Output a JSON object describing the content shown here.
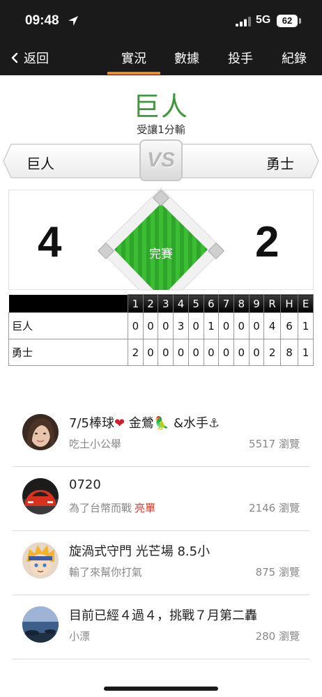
{
  "status_bar": {
    "time": "09:48",
    "network": "5G",
    "battery": "62"
  },
  "nav": {
    "back_label": "返回",
    "tabs": [
      {
        "label": "實況",
        "active": true
      },
      {
        "label": "數據",
        "active": false
      },
      {
        "label": "投手",
        "active": false
      },
      {
        "label": "紀錄",
        "active": false
      }
    ],
    "accent_color": "#f08c1e"
  },
  "game": {
    "winner": "巨人",
    "result": "受讓1分輸",
    "vs": "VS",
    "home_team": "巨人",
    "away_team": "勇士",
    "home_score": "4",
    "away_score": "2",
    "status": "完賽"
  },
  "box_score": {
    "headers": [
      "1",
      "2",
      "3",
      "4",
      "5",
      "6",
      "7",
      "8",
      "9",
      "R",
      "H",
      "E"
    ],
    "rows": [
      {
        "team": "巨人",
        "values": [
          "0",
          "0",
          "0",
          "3",
          "0",
          "1",
          "0",
          "0",
          "0",
          "4",
          "6",
          "1"
        ]
      },
      {
        "team": "勇士",
        "values": [
          "2",
          "0",
          "0",
          "0",
          "0",
          "0",
          "0",
          "0",
          "0",
          "2",
          "8",
          "1"
        ]
      }
    ]
  },
  "posts": [
    {
      "title": "7/5棒球",
      "emoji1": "❤",
      "title_mid": " 金鶯",
      "emoji2": "🦜",
      "title_mid2": " &水手",
      "emoji3": "⚓",
      "author": "吃土小公舉",
      "badge": "",
      "views": "5517 瀏覽",
      "avatar": "woman-avatar-icon"
    },
    {
      "title": "0720",
      "author": "為了台幣而戰",
      "badge": "亮單",
      "views": "2146 瀏覽",
      "avatar": "red-car-avatar-icon"
    },
    {
      "title": "旋渦式守門 光芒場 8.5小",
      "author": "輸了來幫你打氣",
      "badge": "",
      "views": "875 瀏覽",
      "avatar": "anime-boy-avatar-icon"
    },
    {
      "title": "目前已經４過４，挑戰７月第二轟",
      "author": "小漂",
      "badge": "",
      "views": "280 瀏覽",
      "avatar": "seascape-avatar-icon"
    }
  ]
}
